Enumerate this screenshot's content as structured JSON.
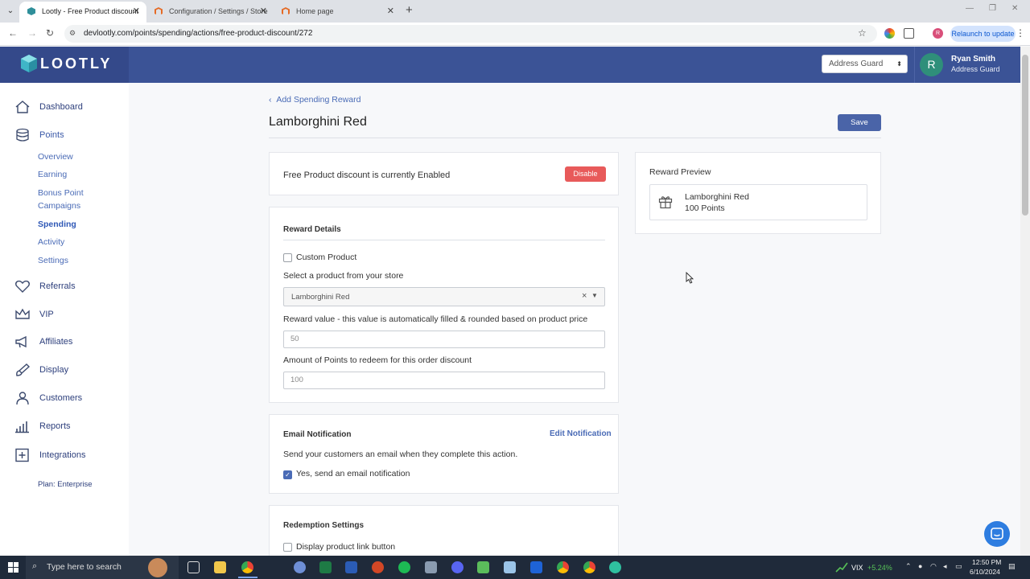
{
  "browser": {
    "tabs": [
      {
        "title": "Lootly - Free Product discount",
        "active": true
      },
      {
        "title": "Configuration / Settings / Store",
        "active": false
      },
      {
        "title": "Home page",
        "active": false
      }
    ],
    "url": "devlootly.com/points/spending/actions/free-product-discount/272",
    "relaunch_label": "Relaunch to update",
    "profile_initial": "R"
  },
  "header": {
    "logo_text": "LOOTLY",
    "store_selector": "Address Guard",
    "user_initial": "R",
    "user_name": "Ryan Smith",
    "user_store": "Address Guard"
  },
  "sidebar": {
    "items": [
      {
        "label": "Dashboard",
        "icon": "home-icon"
      },
      {
        "label": "Points",
        "icon": "coins-icon"
      },
      {
        "label": "Referrals",
        "icon": "heart-icon"
      },
      {
        "label": "VIP",
        "icon": "crown-icon"
      },
      {
        "label": "Affiliates",
        "icon": "megaphone-icon"
      },
      {
        "label": "Display",
        "icon": "brush-icon"
      },
      {
        "label": "Customers",
        "icon": "user-icon"
      },
      {
        "label": "Reports",
        "icon": "bar-chart-icon"
      },
      {
        "label": "Integrations",
        "icon": "plus-square-icon"
      }
    ],
    "points_sub": [
      "Overview",
      "Earning",
      "Bonus Point",
      "Campaigns",
      "Spending",
      "Activity",
      "Settings"
    ],
    "plan": "Plan: Enterprise"
  },
  "main": {
    "back_link": "Add Spending Reward",
    "title": "Lamborghini Red",
    "save_label": "Save",
    "status_prefix": "Free Product discount is currently",
    "status_value": "Enabled",
    "disable_label": "Disable",
    "reward_details": {
      "heading": "Reward Details",
      "custom_product_label": "Custom Product",
      "select_label": "Select a product from your store",
      "selected_product": "Lamborghini Red",
      "reward_value_label": "Reward value - this value is automatically filled & rounded based on product price",
      "reward_value": "50",
      "points_label": "Amount of Points to redeem for this order discount",
      "points_value": "100"
    },
    "email": {
      "heading": "Email Notification",
      "edit_label": "Edit Notification",
      "description": "Send your customers an email when they complete this action.",
      "checkbox_label": "Yes, send an email notification"
    },
    "redemption": {
      "heading": "Redemption Settings",
      "checkbox_label": "Display product link button"
    },
    "preview": {
      "heading": "Reward Preview",
      "name": "Lamborghini Red",
      "points": "100 Points"
    }
  },
  "taskbar": {
    "search_placeholder": "Type here to search",
    "vix_label": "VIX",
    "vix_change": "+5.24%",
    "time": "12:50 PM",
    "date": "6/10/2024"
  },
  "colors": {
    "header_bg": "#3b5396",
    "accent": "#4a6bb6",
    "danger": "#e85a5a"
  }
}
